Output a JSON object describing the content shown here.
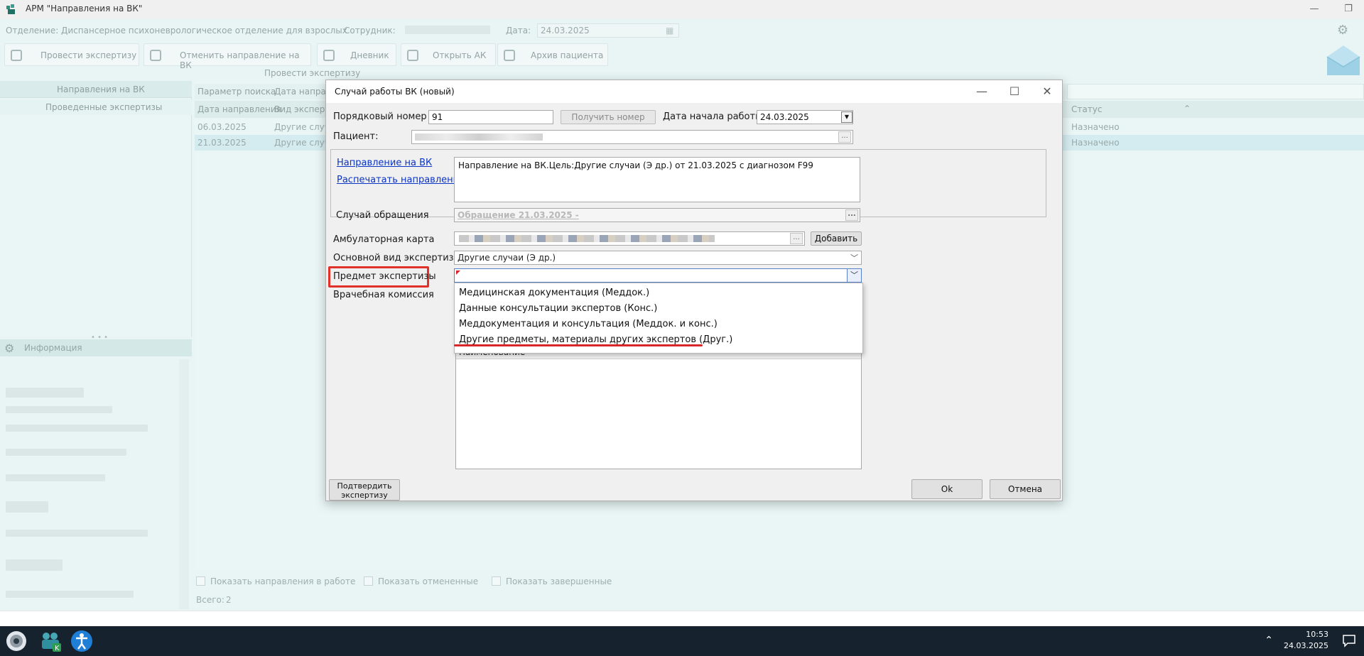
{
  "window": {
    "title": "АРМ \"Направления на ВК\"",
    "minimize_glyph": "—",
    "restore_glyph": "❐"
  },
  "header": {
    "department_label": "Отделение:",
    "department_value": "Диспансерное психоневрологическое отделение для взрослых",
    "employee_label": "Сотрудник:",
    "date_label": "Дата:",
    "date_value": "24.03.2025"
  },
  "toolbar": {
    "buttons": [
      {
        "label": "Провести экспертизу",
        "icon": "people-search-icon"
      },
      {
        "label": "Отменить направление на ВК",
        "icon": "people-cancel-icon"
      },
      {
        "label": "Дневник",
        "icon": "notebook-icon"
      },
      {
        "label": "Открыть АК",
        "icon": "archive-box-icon"
      },
      {
        "label": "Архив пациента",
        "icon": "patient-archive-icon"
      }
    ],
    "group_caption": "Провести экспертизу"
  },
  "left_panel": {
    "header": "Направления на ВК",
    "item": "Проведенные экспертизы",
    "info_title": "Информация"
  },
  "grid": {
    "search_param_label": "Параметр поиска",
    "search_date_label": "Дата направ",
    "columns": [
      "Дата направления",
      "Вид экспертиз",
      "Статус"
    ],
    "rows": [
      {
        "date": "06.03.2025",
        "type": "Другие случа",
        "status": "Назначено"
      },
      {
        "date": "21.03.2025",
        "type": "Другие случа",
        "status": "Назначено"
      }
    ],
    "options": [
      "Показать направления в работе",
      "Показать отмененные",
      "Показать завершенные"
    ],
    "total_label": "Всего:",
    "total_value": "2"
  },
  "dialog": {
    "title": "Случай работы ВК (новый)",
    "order_number_label": "Порядковый номер",
    "order_number_value": "91",
    "get_number_button": "Получить номер",
    "start_date_label": "Дата начала работы",
    "start_date_value": "24.03.2025",
    "patient_label": "Пациент:",
    "referral_link": "Направление на ВК",
    "print_referral_link": "Распечатать направление",
    "referral_text": "Направление на ВК.Цель:Другие случаи (Э др.) от 21.03.2025 с диагнозом F99",
    "case_label": "Случай обращения",
    "case_value": "Обращение 21.03.2025 -",
    "amb_card_label": "Амбулаторная карта",
    "add_button": "Добавить",
    "main_type_label": "Основной вид экспертизы",
    "main_type_value": "Другие случаи (Э др.)",
    "subject_label": "Предмет экспертизы",
    "subject_value": "",
    "commission_label": "Врачебная комиссия",
    "subject_options": [
      "Медицинская документация (Меддок.)",
      "Данные консультации экспертов (Конс.)",
      "Меддокументация и консультация (Меддок. и конс.)",
      "Другие предметы, материалы других экспертов (Друг.)"
    ],
    "table_header": "Наименование",
    "confirm_button": "Подтвердить экспертизу",
    "ok_button": "Ok",
    "cancel_button": "Отмена",
    "ellipsis": "..."
  },
  "taskbar": {
    "time": "10:53",
    "date": "24.03.2025"
  },
  "colors": {
    "accent_red": "#e0322b",
    "link_blue": "#0b35c4",
    "taskbar": "#16232f"
  }
}
